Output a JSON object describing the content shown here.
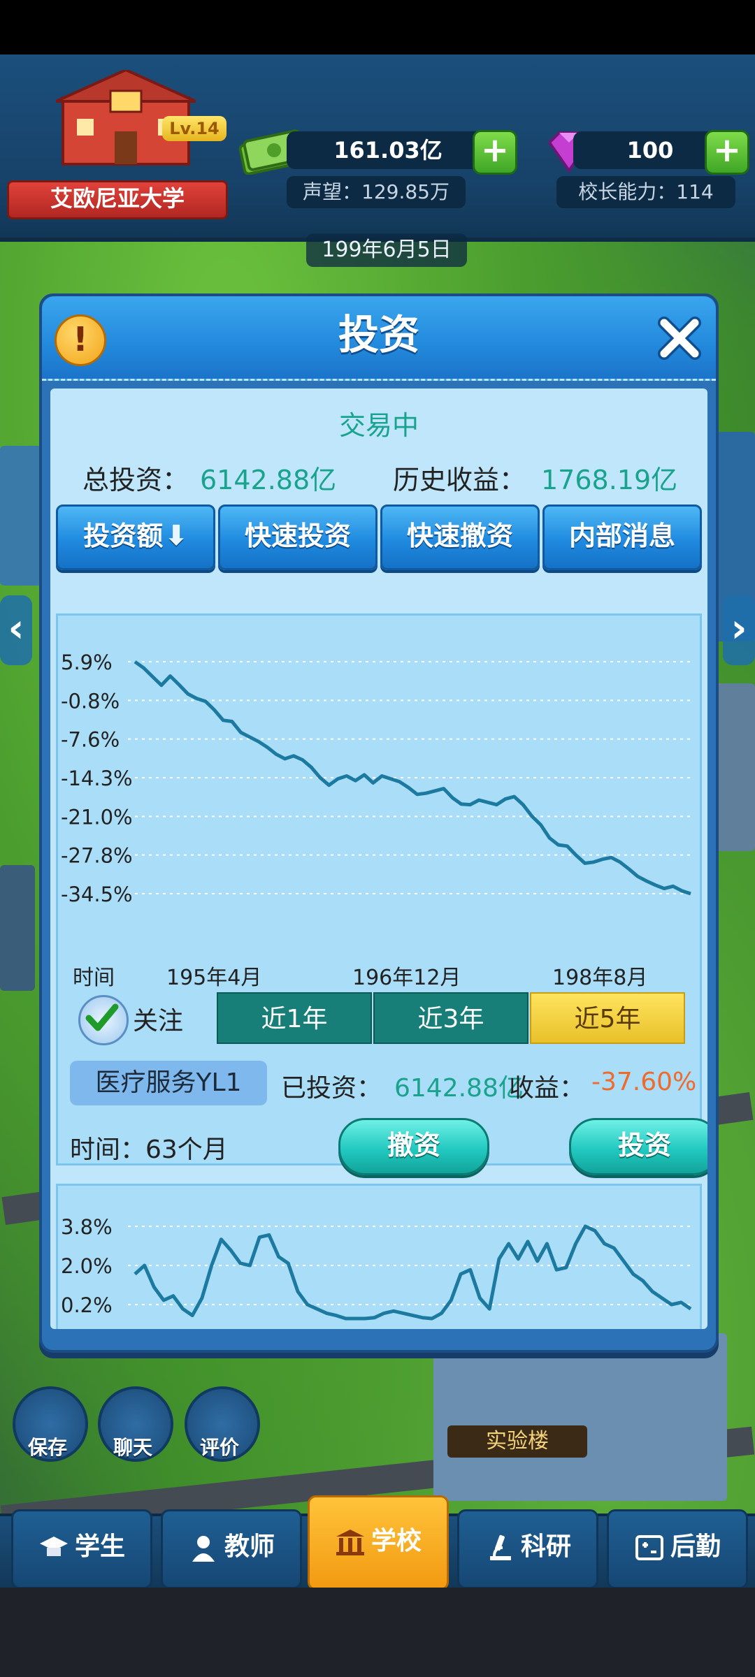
{
  "header": {
    "university_name": "艾欧尼亚大学",
    "level": "Lv.14",
    "money": "161.03亿",
    "reputation": "声望：129.85万",
    "gems": "100",
    "principal_ability": "校长能力：114",
    "date": "199年6月5日"
  },
  "modal": {
    "title": "投资",
    "status": "交易中",
    "total_investment_label": "总投资：",
    "total_investment_value": "6142.88亿",
    "history_income_label": "历史收益：",
    "history_income_value": "1768.19亿",
    "buttons": [
      "投资额",
      "快速投资",
      "快速撤资",
      "内部消息"
    ],
    "follow_label": "关注",
    "ranges": [
      "近1年",
      "近3年",
      "近5年"
    ],
    "active_range": "近5年",
    "fund_name": "医疗服务YL1",
    "invested_label": "已投资：",
    "invested_value": "6142.88亿",
    "income_label": "收益：",
    "income_value": "-37.60%",
    "time_label": "时间：",
    "time_value": "63个月",
    "withdraw_button": "撤资",
    "invest_button": "投资"
  },
  "chart_data": [
    {
      "type": "line",
      "title": "",
      "xlabel": "时间",
      "ylabel": "",
      "x_tick_labels": [
        "195年4月",
        "196年12月",
        "198年8月"
      ],
      "y_tick_labels": [
        "5.9%",
        "-0.8%",
        "-7.6%",
        "-14.3%",
        "-21.0%",
        "-27.8%",
        "-34.5%"
      ],
      "ylim": [
        -34.5,
        5.9
      ],
      "grid": true,
      "series": [
        {
          "name": "",
          "values": [
            5.9,
            4.8,
            3.3,
            1.8,
            3.4,
            1.9,
            0.3,
            -0.5,
            -1.0,
            -2.5,
            -4.3,
            -4.5,
            -6.4,
            -7.2,
            -8.0,
            -9.0,
            -10.2,
            -11.0,
            -10.5,
            -11.2,
            -12.5,
            -14.3,
            -15.6,
            -14.5,
            -14.0,
            -14.8,
            -13.8,
            -15.2,
            -14.0,
            -14.5,
            -15.0,
            -16.0,
            -17.2,
            -17.0,
            -16.6,
            -16.2,
            -17.8,
            -18.9,
            -19.0,
            -18.2,
            -18.6,
            -19.0,
            -18.0,
            -17.6,
            -19.0,
            -21.0,
            -22.5,
            -24.8,
            -26.0,
            -26.2,
            -27.8,
            -29.2,
            -29.0,
            -28.5,
            -28.2,
            -29.0,
            -30.2,
            -31.5,
            -32.3,
            -33.0,
            -33.6,
            -33.2,
            -34.0,
            -34.5
          ]
        }
      ]
    },
    {
      "type": "line",
      "title": "",
      "xlabel": "",
      "ylabel": "",
      "y_tick_labels": [
        "3.8%",
        "2.0%",
        "0.2%"
      ],
      "ylim": [
        0.2,
        3.8
      ],
      "grid": true,
      "series": [
        {
          "name": "",
          "values": [
            1.6,
            2.0,
            1.0,
            0.4,
            0.6,
            0.0,
            -0.3,
            0.5,
            2.0,
            3.2,
            2.7,
            2.1,
            2.0,
            3.3,
            3.4,
            2.4,
            2.1,
            0.8,
            0.2,
            0.0,
            -0.2,
            -0.3,
            -0.5,
            -0.6,
            -0.6,
            -0.4,
            -0.2,
            -0.1,
            -0.2,
            -0.3,
            -0.4,
            -0.5,
            -0.2,
            0.4,
            1.6,
            1.8,
            0.5,
            0.0,
            2.3,
            3.0,
            2.3,
            3.1,
            2.2,
            3.0,
            1.8,
            1.9,
            3.0,
            3.8,
            3.6,
            3.0,
            2.8,
            2.2,
            1.6,
            1.3,
            0.8,
            0.5,
            0.2,
            0.3,
            0.0
          ]
        }
      ]
    }
  ],
  "quick": {
    "save": "保存",
    "chat": "聊天",
    "review": "评价",
    "lab": "实验楼"
  },
  "nav": {
    "tabs": [
      "学生",
      "教师",
      "学校",
      "科研",
      "后勤"
    ],
    "active": "学校"
  },
  "colors": {
    "accent_green": "#1aa38c",
    "loss_orange": "#ef6a2b",
    "line_blue": "#1c7aa0",
    "active_gold": "#f2c530",
    "range_teal": "#177f77"
  }
}
